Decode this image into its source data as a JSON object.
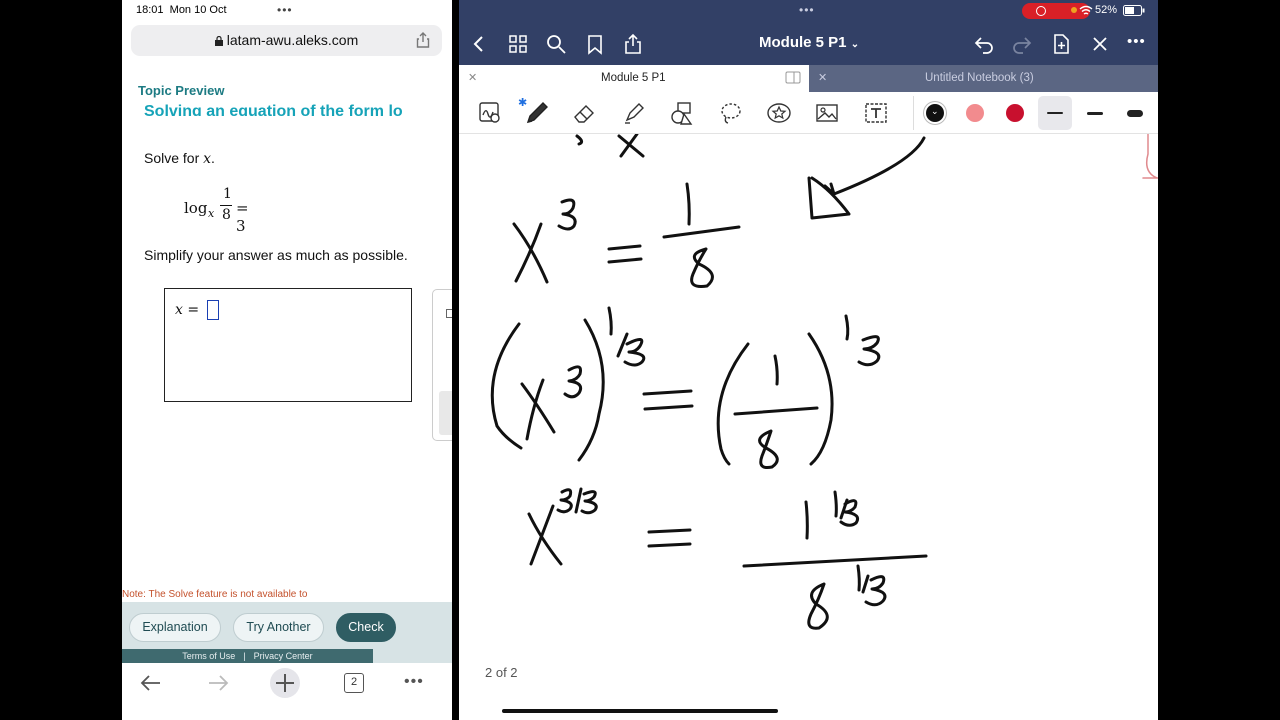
{
  "left_app": {
    "status_time": "18:01",
    "status_date": "Mon 10 Oct",
    "url": "latam-awu.aleks.com",
    "topic_preview": "Topic Preview",
    "clipped_heading": "Solving an equation of the form lo",
    "solve_for_prefix": "Solve for ",
    "solve_for_var": "x",
    "solve_for_suffix": ".",
    "equation": {
      "log": "log",
      "base": "x",
      "numerator": "1",
      "denominator": "8",
      "rhs": "= 3"
    },
    "simplify_text": "Simplify your answer as much as possible.",
    "answer_label": "x =",
    "note": "Note: The Solve feature is not available to students.",
    "buttons": {
      "explanation": "Explanation",
      "try_another": "Try Another",
      "check": "Check"
    },
    "legal": {
      "terms": "Terms of Use",
      "separator": "|",
      "privacy": "Privacy Center"
    },
    "tab_count": "2"
  },
  "right_app": {
    "battery": "52%",
    "title": "Module 5 P1",
    "tabs": [
      {
        "label": "Module 5 P1",
        "active": true
      },
      {
        "label": "Untitled Notebook (3)",
        "active": false
      }
    ],
    "colors": {
      "black": "#111111",
      "pink": "#f28b8e",
      "red": "#c8102e",
      "accent_bar": "#324066"
    },
    "page_indicator": "2 of 2"
  }
}
